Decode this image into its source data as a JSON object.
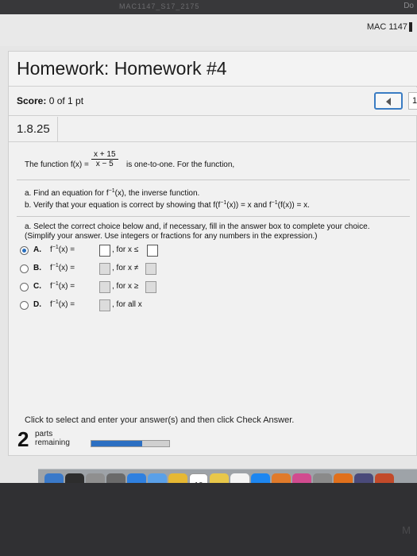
{
  "top_strip": {
    "tab_text": "MAC1147_S17_2175",
    "corner_text": "Do"
  },
  "screen": {
    "mac_label": "MAC 1147"
  },
  "homework": {
    "title": "Homework: Homework #4",
    "score_label": "Score:",
    "score_value": "0 of 1 pt",
    "question_number": "1.8.25",
    "nav_number": "1"
  },
  "question": {
    "intro_pre": "The function f(x) =",
    "fraction_num": "x + 15",
    "fraction_den": "x − 5",
    "intro_post": "is one-to-one. For the function,",
    "part_a": "a. Find an equation for f",
    "part_a_sup": "−1",
    "part_a_post": "(x), the inverse function.",
    "part_b": "b. Verify that your equation is correct by showing that f(f",
    "part_b_sup": "−1",
    "part_b_mid": "(x)) = x and f",
    "part_b_sup2": "−1",
    "part_b_post": "(f(x)) = x.",
    "instruction_1": "a. Select the correct choice below and, if necessary, fill in the answer box to complete your choice.",
    "instruction_2": "(Simplify your answer. Use integers or fractions for any numbers in the expression.)"
  },
  "choices": [
    {
      "letter": "A.",
      "fx": "f",
      "sup": "−1",
      "fx_post": "(x) =",
      "cond": ", for x ≤",
      "selected": true
    },
    {
      "letter": "B.",
      "fx": "f",
      "sup": "−1",
      "fx_post": "(x) =",
      "cond": ", for x ≠",
      "selected": false
    },
    {
      "letter": "C.",
      "fx": "f",
      "sup": "−1",
      "fx_post": "(x) =",
      "cond": ", for x ≥",
      "selected": false
    },
    {
      "letter": "D.",
      "fx": "f",
      "sup": "−1",
      "fx_post": "(x) =",
      "cond": ", for all x",
      "selected": false
    }
  ],
  "footer": {
    "message": "Click to select and enter your answer(s) and then click Check Answer.",
    "parts_count": "2",
    "parts_label_1": "parts",
    "parts_label_2": "remaining",
    "progress_fraction": 0.65
  },
  "dock": {
    "icons": [
      "finder-icon",
      "siri-icon",
      "launchpad-icon",
      "rocket-icon",
      "safari-icon",
      "mail-icon",
      "photos-icon",
      "calendar-icon",
      "notes-icon",
      "reminders-icon",
      "app-store-icon",
      "books-icon",
      "itunes-icon",
      "system-preferences-icon",
      "vlc-icon",
      "imovie-icon",
      "keynote-icon"
    ],
    "calendar_day": "10"
  },
  "bottom_bezel": {
    "mark": "M"
  }
}
